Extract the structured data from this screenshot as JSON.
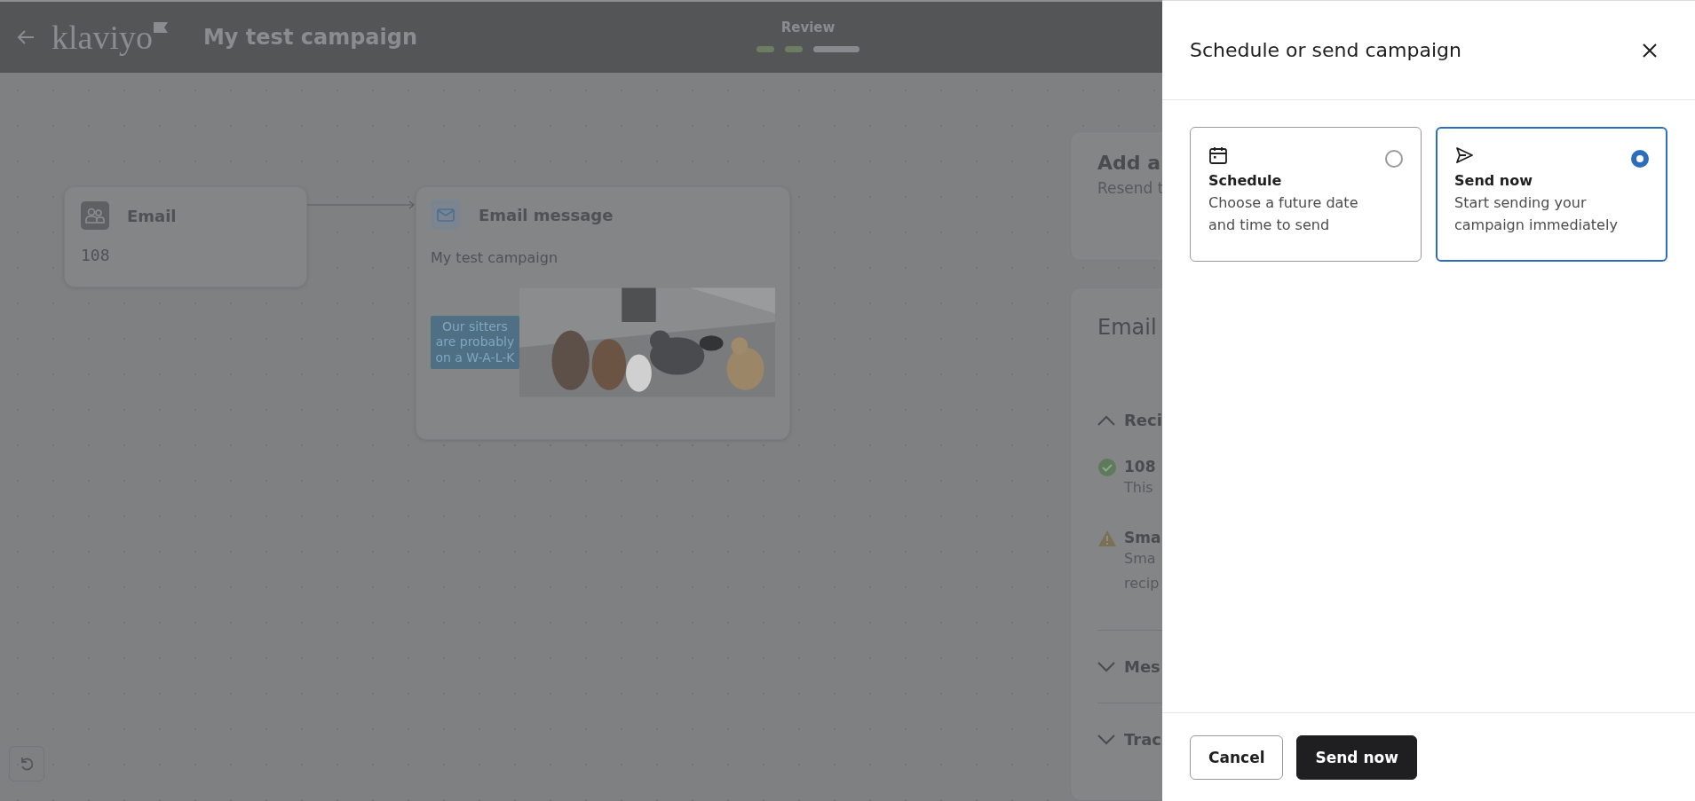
{
  "header": {
    "logo": "klaviyo",
    "campaign_title": "My test campaign",
    "stepper": {
      "label": "Review",
      "steps": [
        {
          "complete": true
        },
        {
          "complete": true
        },
        {
          "complete": false
        }
      ]
    }
  },
  "canvas": {
    "nodes": [
      {
        "kind": "audience",
        "title": "Email",
        "count": "108"
      },
      {
        "kind": "message",
        "title": "Email message",
        "subject": "My test campaign",
        "banner_text": "Our sitters are probably on a W-A-L-K"
      }
    ]
  },
  "side_panel": {
    "resend_card": {
      "title": "Add a",
      "subtitle": "Resend t"
    },
    "email_card": {
      "title": "Email",
      "sections": [
        {
          "title": "Reci",
          "expanded": true,
          "items": [
            {
              "kind": "success",
              "title": "108",
              "lines": [
                "This"
              ]
            },
            {
              "kind": "warning",
              "title": "Sma",
              "lines": [
                "Sma",
                "recip"
              ]
            }
          ]
        },
        {
          "title": "Mes",
          "expanded": false
        },
        {
          "title": "Trac",
          "expanded": false
        }
      ]
    }
  },
  "drawer": {
    "title": "Schedule or send campaign",
    "options": [
      {
        "kind": "schedule",
        "title": "Schedule",
        "description": "Choose a future date and time to send",
        "selected": false
      },
      {
        "kind": "send",
        "title": "Send now",
        "description": "Start sending your campaign immediately",
        "selected": true
      }
    ],
    "buttons": [
      {
        "kind": "secondary",
        "label": "Cancel"
      },
      {
        "kind": "primary",
        "label": "Send now"
      }
    ]
  }
}
